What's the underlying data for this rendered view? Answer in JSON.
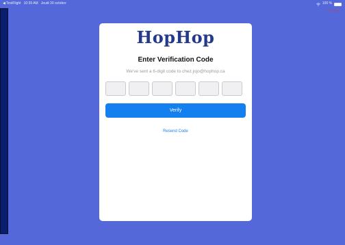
{
  "status_bar": {
    "back_arrow": "◀",
    "app": "TestFlight",
    "time": "10:39 AM",
    "date": "Jeudi 30 octobre",
    "battery_text": "100 %",
    "battery_level": 1.0
  },
  "debug_tag": "Dev mode",
  "logo": "HopHop",
  "verification": {
    "title": "Enter Verification Code",
    "subtitle": "We've sent a 6-digit code to chez.jojo@hophop.ca",
    "digits": [
      "",
      "",
      "",
      "",
      "",
      ""
    ],
    "verify_label": "Verify",
    "resend_label": "Resend Code"
  },
  "colors": {
    "background": "#5468da",
    "brand": "#23398a",
    "accent": "#1480f0"
  }
}
